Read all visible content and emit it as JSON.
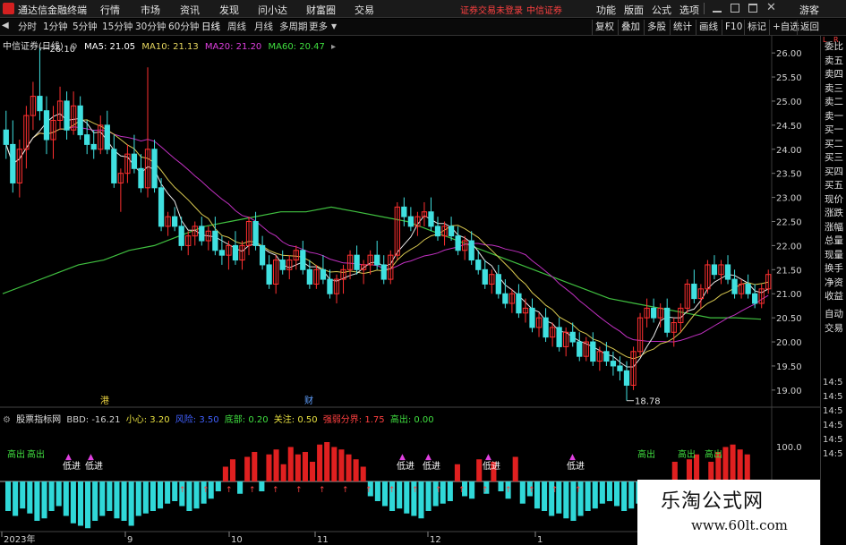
{
  "menubar": {
    "app_title": "通达信金融终端",
    "menus": [
      "行情",
      "市场",
      "资讯",
      "发现",
      "问小达",
      "财富圈",
      "交易"
    ],
    "status_text": "证券交易未登录",
    "broker_text": "中信证券",
    "right_items": [
      "功能",
      "版面",
      "公式",
      "选项"
    ],
    "user": "游客"
  },
  "toolbar": {
    "periods": [
      "分时",
      "1分钟",
      "5分钟",
      "15分钟",
      "30分钟",
      "60分钟",
      "日线",
      "周线",
      "月线",
      "多周期",
      "更多"
    ],
    "active_period": "日线",
    "right_buttons": [
      "复权",
      "叠加",
      "多股",
      "统计",
      "画线",
      "F10",
      "标记",
      "+自选",
      "返回"
    ]
  },
  "main_chart": {
    "stock_title": "中信证券(日线)",
    "ma_legend": [
      {
        "label": "MA5: 21.05",
        "color": "#ffffff"
      },
      {
        "label": "MA10: 21.13",
        "color": "#e8d860"
      },
      {
        "label": "MA20: 21.20",
        "color": "#e040e0"
      },
      {
        "label": "MA60: 20.47",
        "color": "#40e040"
      }
    ],
    "y_axis_labels": [
      "26.00",
      "25.50",
      "25.00",
      "24.50",
      "24.00",
      "23.50",
      "23.00",
      "22.50",
      "22.00",
      "21.50",
      "21.00",
      "20.50",
      "20.00",
      "19.50",
      "19.00"
    ],
    "high_label": "26.10",
    "low_label": "18.78",
    "event_marks": [
      "港",
      "财"
    ]
  },
  "right_panel": {
    "items": [
      "委比",
      "卖五",
      "卖四",
      "卖三",
      "卖二",
      "卖一",
      "买一",
      "买二",
      "买三",
      "买四",
      "买五",
      "现价",
      "涨跌",
      "涨幅",
      "总量",
      "现量",
      "换手",
      "净资",
      "收益",
      "自动",
      "交易"
    ],
    "time_labels": [
      "14:5",
      "14:5",
      "14:5",
      "14:5",
      "14:5",
      "14:5"
    ],
    "corner_top": "R",
    "corner_l": "L"
  },
  "indicator": {
    "name": "股票指标网",
    "values": [
      {
        "label": "BBD: -16.21",
        "color": "#d0d0d0"
      },
      {
        "label": "小心: 3.20",
        "color": "#e8e040"
      },
      {
        "label": "风险: 3.50",
        "color": "#4060ff"
      },
      {
        "label": "底部: 0.20",
        "color": "#40e040"
      },
      {
        "label": "关注: 0.50",
        "color": "#e8e040"
      },
      {
        "label": "强弱分界: 1.75",
        "color": "#ff4040"
      },
      {
        "label": "高出: 0.00",
        "color": "#40e040"
      }
    ],
    "y_label": "100.0",
    "signal_labels": [
      "高出",
      "高出",
      "低进",
      "低进",
      "低进",
      "低进",
      "低进",
      "低进",
      "高出",
      "高出",
      "高出"
    ]
  },
  "x_axis": {
    "labels": [
      "2023年",
      "9",
      "10",
      "11",
      "12",
      "1"
    ]
  },
  "watermark": {
    "title": "乐淘公式网",
    "url": "www.60lt.com"
  },
  "chart_data": [
    {
      "type": "candlestick",
      "title": "中信证券(日线)",
      "y_range": [
        18.7,
        26.3
      ],
      "ohlc": [
        [
          24.4,
          24.8,
          23.8,
          24.1
        ],
        [
          24.1,
          24.6,
          23.1,
          23.3
        ],
        [
          23.3,
          24.2,
          23.0,
          24.0
        ],
        [
          24.0,
          24.9,
          23.6,
          24.7
        ],
        [
          24.7,
          25.4,
          24.4,
          25.1
        ],
        [
          25.1,
          26.1,
          24.6,
          24.8
        ],
        [
          24.8,
          25.1,
          23.9,
          24.2
        ],
        [
          24.2,
          24.9,
          23.8,
          24.6
        ],
        [
          24.6,
          25.3,
          24.4,
          25.0
        ],
        [
          25.0,
          25.2,
          24.2,
          24.4
        ],
        [
          24.4,
          25.2,
          24.3,
          24.9
        ],
        [
          24.9,
          25.1,
          24.2,
          24.3
        ],
        [
          24.3,
          24.6,
          23.9,
          24.1
        ],
        [
          24.1,
          24.4,
          23.8,
          24.0
        ],
        [
          24.0,
          24.7,
          23.9,
          24.5
        ],
        [
          24.5,
          24.8,
          23.9,
          24.0
        ],
        [
          24.0,
          24.3,
          23.2,
          23.3
        ],
        [
          23.3,
          23.6,
          22.7,
          23.5
        ],
        [
          23.5,
          24.1,
          23.3,
          23.9
        ],
        [
          23.9,
          24.3,
          23.5,
          23.6
        ],
        [
          23.6,
          23.9,
          23.1,
          23.2
        ],
        [
          23.2,
          25.7,
          23.0,
          24.0
        ],
        [
          24.0,
          24.2,
          23.1,
          23.2
        ],
        [
          23.2,
          23.4,
          22.3,
          22.4
        ],
        [
          22.4,
          22.7,
          22.2,
          22.6
        ],
        [
          22.6,
          22.8,
          22.3,
          22.4
        ],
        [
          22.4,
          22.6,
          21.9,
          22.0
        ],
        [
          22.0,
          22.3,
          21.8,
          22.2
        ],
        [
          22.2,
          22.5,
          22.0,
          22.4
        ],
        [
          22.4,
          22.6,
          22.0,
          22.1
        ],
        [
          22.1,
          22.4,
          21.9,
          22.3
        ],
        [
          22.3,
          22.6,
          21.8,
          21.9
        ],
        [
          21.9,
          22.2,
          21.6,
          21.8
        ],
        [
          21.8,
          22.1,
          21.5,
          22.0
        ],
        [
          22.0,
          22.3,
          21.6,
          21.7
        ],
        [
          21.7,
          22.1,
          21.5,
          22.0
        ],
        [
          22.0,
          22.6,
          21.8,
          22.5
        ],
        [
          22.5,
          22.7,
          21.9,
          22.0
        ],
        [
          22.0,
          22.2,
          21.5,
          21.6
        ],
        [
          21.6,
          21.8,
          21.1,
          21.2
        ],
        [
          21.2,
          21.8,
          21.0,
          21.7
        ],
        [
          21.7,
          21.9,
          21.4,
          21.5
        ],
        [
          21.5,
          21.8,
          21.3,
          21.7
        ],
        [
          21.7,
          22.0,
          21.5,
          21.9
        ],
        [
          21.9,
          22.1,
          21.4,
          21.5
        ],
        [
          21.5,
          21.7,
          21.1,
          21.2
        ],
        [
          21.2,
          21.6,
          21.1,
          21.5
        ],
        [
          21.5,
          21.8,
          21.2,
          21.3
        ],
        [
          21.3,
          21.5,
          20.9,
          21.0
        ],
        [
          21.0,
          21.4,
          20.8,
          21.3
        ],
        [
          21.3,
          21.6,
          21.0,
          21.5
        ],
        [
          21.5,
          21.9,
          21.3,
          21.8
        ],
        [
          21.8,
          22.0,
          21.4,
          21.5
        ],
        [
          21.5,
          21.7,
          21.2,
          21.6
        ],
        [
          21.6,
          21.9,
          21.4,
          21.8
        ],
        [
          21.8,
          22.1,
          21.5,
          21.6
        ],
        [
          21.6,
          21.8,
          21.2,
          21.3
        ],
        [
          21.3,
          21.9,
          21.2,
          21.8
        ],
        [
          21.8,
          22.9,
          21.7,
          22.8
        ],
        [
          22.8,
          23.0,
          22.4,
          22.6
        ],
        [
          22.6,
          22.8,
          22.3,
          22.4
        ],
        [
          22.4,
          22.7,
          22.2,
          22.6
        ],
        [
          22.6,
          22.9,
          22.4,
          22.7
        ],
        [
          22.7,
          23.0,
          22.3,
          22.4
        ],
        [
          22.4,
          22.6,
          22.1,
          22.2
        ],
        [
          22.2,
          22.5,
          22.0,
          22.4
        ],
        [
          22.4,
          22.6,
          22.1,
          22.2
        ],
        [
          22.2,
          22.4,
          21.8,
          21.9
        ],
        [
          21.9,
          22.2,
          21.7,
          22.1
        ],
        [
          22.1,
          22.3,
          21.6,
          21.7
        ],
        [
          21.7,
          21.9,
          21.4,
          21.5
        ],
        [
          21.5,
          21.7,
          21.1,
          21.2
        ],
        [
          21.2,
          21.5,
          21.0,
          21.4
        ],
        [
          21.4,
          21.6,
          20.9,
          21.0
        ],
        [
          21.0,
          21.3,
          20.7,
          20.8
        ],
        [
          20.8,
          21.1,
          20.6,
          21.0
        ],
        [
          21.0,
          21.2,
          20.5,
          20.6
        ],
        [
          20.6,
          20.9,
          20.4,
          20.7
        ],
        [
          20.7,
          20.9,
          20.2,
          20.3
        ],
        [
          20.3,
          20.6,
          20.1,
          20.5
        ],
        [
          20.5,
          20.7,
          20.0,
          20.1
        ],
        [
          20.1,
          20.4,
          19.9,
          20.3
        ],
        [
          20.3,
          20.5,
          19.8,
          19.9
        ],
        [
          19.9,
          20.3,
          19.7,
          20.2
        ],
        [
          20.2,
          20.4,
          19.9,
          20.0
        ],
        [
          20.0,
          20.2,
          19.6,
          19.7
        ],
        [
          19.7,
          20.1,
          19.6,
          20.0
        ],
        [
          20.0,
          20.2,
          19.5,
          19.6
        ],
        [
          19.6,
          19.9,
          19.4,
          19.8
        ],
        [
          19.8,
          20.0,
          19.5,
          19.6
        ],
        [
          19.6,
          19.8,
          19.3,
          19.5
        ],
        [
          19.5,
          19.7,
          19.2,
          19.4
        ],
        [
          19.4,
          19.6,
          18.78,
          19.1
        ],
        [
          19.1,
          19.9,
          19.0,
          19.8
        ],
        [
          19.8,
          20.6,
          19.7,
          20.5
        ],
        [
          20.5,
          20.9,
          20.3,
          20.7
        ],
        [
          20.7,
          20.9,
          20.4,
          20.5
        ],
        [
          20.5,
          20.8,
          20.3,
          20.7
        ],
        [
          20.7,
          20.9,
          20.1,
          20.2
        ],
        [
          20.2,
          20.5,
          19.9,
          20.4
        ],
        [
          20.4,
          20.8,
          20.2,
          20.7
        ],
        [
          20.7,
          21.3,
          20.6,
          21.2
        ],
        [
          21.2,
          21.5,
          20.8,
          20.9
        ],
        [
          20.9,
          21.2,
          20.7,
          21.1
        ],
        [
          21.1,
          21.7,
          21.0,
          21.6
        ],
        [
          21.6,
          21.8,
          21.3,
          21.4
        ],
        [
          21.4,
          21.7,
          21.2,
          21.6
        ],
        [
          21.6,
          21.8,
          21.2,
          21.3
        ],
        [
          21.3,
          21.5,
          20.9,
          21.0
        ],
        [
          21.0,
          21.3,
          20.9,
          21.2
        ],
        [
          21.2,
          21.4,
          20.9,
          21.0
        ],
        [
          21.0,
          21.2,
          20.7,
          20.8
        ],
        [
          20.8,
          21.2,
          20.7,
          21.1
        ],
        [
          21.1,
          21.5,
          21.0,
          21.4
        ]
      ],
      "ma60": [
        21.0,
        21.2,
        21.4,
        21.6,
        21.7,
        21.9,
        22.0,
        22.2,
        22.4,
        22.5,
        22.6,
        22.7,
        22.7,
        22.8,
        22.7,
        22.6,
        22.5,
        22.3,
        22.1,
        21.9,
        21.7,
        21.5,
        21.3,
        21.1,
        20.9,
        20.8,
        20.7,
        20.6,
        20.5,
        20.5,
        20.47
      ]
    },
    {
      "type": "bar",
      "title": "股票指标网",
      "y_range": [
        -100,
        100
      ],
      "values": [
        -60,
        -70,
        -55,
        -65,
        -80,
        -75,
        -60,
        -50,
        -70,
        -85,
        -90,
        -95,
        -80,
        -70,
        -60,
        -75,
        -80,
        -90,
        -70,
        -65,
        -60,
        -55,
        -45,
        -40,
        -50,
        -60,
        -55,
        -45,
        -35,
        -20,
        30,
        45,
        -25,
        50,
        60,
        -20,
        55,
        65,
        35,
        70,
        55,
        60,
        40,
        75,
        80,
        70,
        65,
        55,
        45,
        30,
        -30,
        -40,
        -50,
        -60,
        -55,
        -65,
        -70,
        -75,
        -60,
        -50,
        -45,
        -40,
        35,
        -30,
        -35,
        45,
        -25,
        40,
        -20,
        -35,
        50,
        -45,
        -30,
        -55,
        -60,
        -70,
        -65,
        -75,
        -80,
        -70,
        -60,
        -55,
        -45,
        -40,
        -50,
        -60,
        -55,
        -45,
        -40,
        -30,
        -25,
        -35,
        40,
        -30,
        45,
        55,
        -20,
        40,
        60,
        70,
        75,
        65,
        55,
        -30,
        -45
      ]
    }
  ]
}
